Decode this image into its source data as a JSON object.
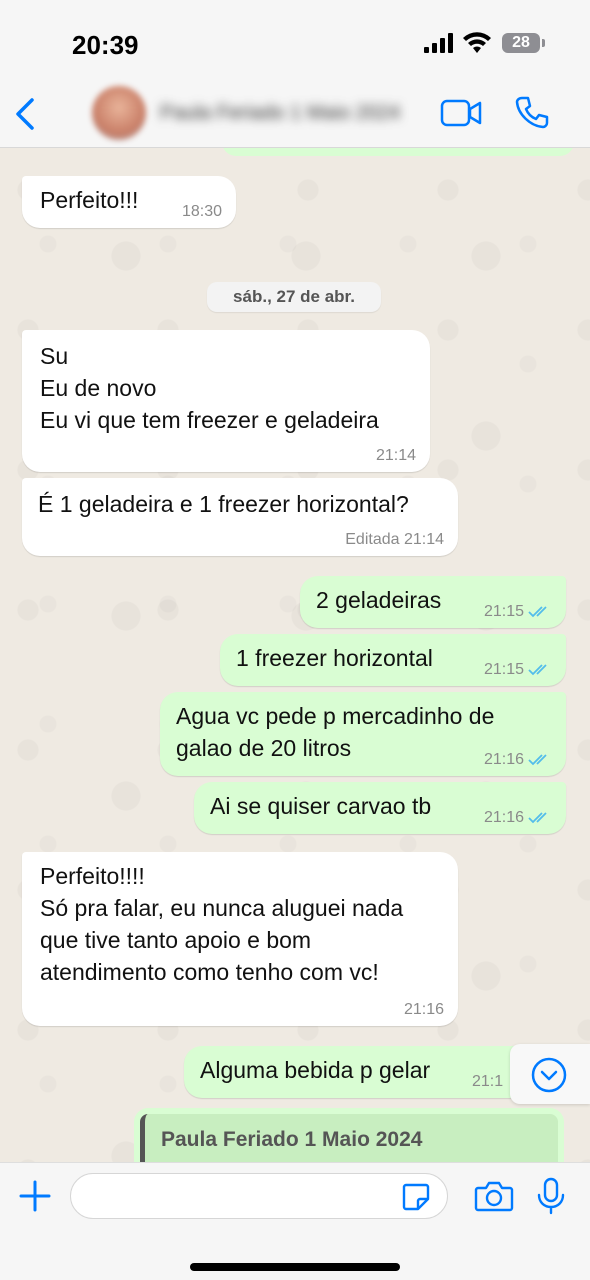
{
  "status_bar": {
    "time": "20:39",
    "battery": "28"
  },
  "header": {
    "contact_name": "Paula Feriado 1 Maio 2024"
  },
  "chat": {
    "date_separator": "sáb., 27 de abr.",
    "messages": [
      {
        "dir": "in",
        "text": "Perfeito!!!",
        "time": "18:30"
      },
      {
        "dir": "in",
        "text": "Su\nEu de novo\nEu vi que tem freezer e geladeira",
        "time": "21:14"
      },
      {
        "dir": "in",
        "text": "É 1 geladeira e 1 freezer horizontal?",
        "time": "Editada 21:14"
      },
      {
        "dir": "out",
        "text": "2 geladeiras",
        "time": "21:15"
      },
      {
        "dir": "out",
        "text": "1 freezer horizontal",
        "time": "21:15"
      },
      {
        "dir": "out",
        "text": "Agua vc pede p mercadinho de\ngalao de 20 litros",
        "time": "21:16"
      },
      {
        "dir": "out",
        "text": "Ai se quiser carvao tb",
        "time": "21:16"
      },
      {
        "dir": "in",
        "text": "Perfeito!!!!\nSó pra falar, eu nunca aluguei nada\nque tive tanto apoio e bom\natendimento como tenho com vc!",
        "time": "21:16"
      },
      {
        "dir": "out",
        "text": "Alguma bebida p gelar",
        "time": "21:1"
      }
    ],
    "quoted_author": "Paula Feriado 1 Maio 2024"
  },
  "input": {
    "placeholder": ""
  },
  "colors": {
    "accent": "#007aff",
    "outgoing": "#d9fdd3",
    "incoming": "#ffffff",
    "read_check": "#53bdeb"
  }
}
